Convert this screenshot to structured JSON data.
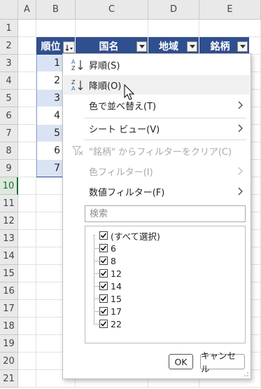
{
  "columns": [
    "A",
    "B",
    "C",
    "D",
    "E"
  ],
  "rows": [
    "1",
    "2",
    "3",
    "4",
    "5",
    "6",
    "7",
    "8",
    "9",
    "10",
    "11",
    "12",
    "13",
    "14",
    "15",
    "16",
    "17",
    "18",
    "19",
    "20",
    "21"
  ],
  "table": {
    "headers": [
      "順位",
      "国名",
      "地域",
      "銘柄"
    ],
    "ranks": [
      "1",
      "2",
      "3",
      "4",
      "5",
      "6",
      "7"
    ]
  },
  "menu": {
    "sort_asc": "昇順(S)",
    "sort_desc": "降順(O)",
    "sort_by_color": "色で並べ替え(T)",
    "sheet_view": "シート ビュー(V)",
    "clear_filter": "\"銘柄\" からフィルターをクリア(C)",
    "color_filter": "色フィルター(I)",
    "number_filter": "数値フィルター(F)",
    "search_placeholder": "検索",
    "list_items": [
      "(すべて選択)",
      "6",
      "8",
      "12",
      "14",
      "15",
      "17",
      "22"
    ],
    "ok": "OK",
    "cancel": "キャンセル"
  },
  "colors": {
    "header_fill": "#2f4f8f",
    "rank_fill": "#dae3f3",
    "active_row": "#1e6b3a"
  }
}
